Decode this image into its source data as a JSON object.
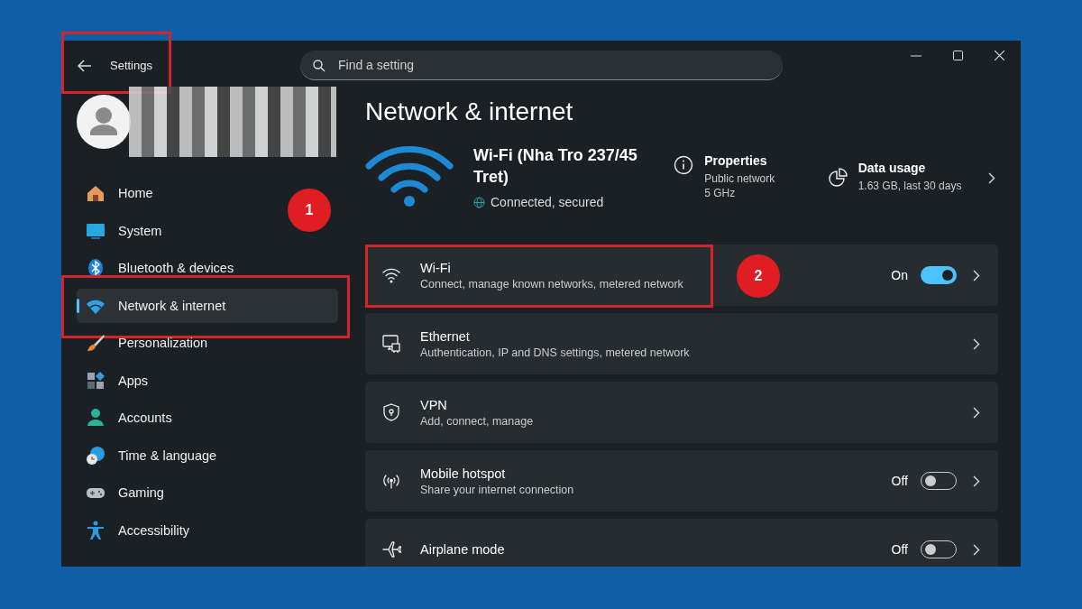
{
  "window": {
    "title": "Settings",
    "highlighted": true
  },
  "search": {
    "placeholder": "Find a setting"
  },
  "sidebar": {
    "items": [
      {
        "label": "Home",
        "kind": "home",
        "selected": false,
        "highlighted": false
      },
      {
        "label": "System",
        "kind": "system",
        "selected": false,
        "highlighted": false
      },
      {
        "label": "Bluetooth & devices",
        "kind": "bluetooth",
        "selected": false,
        "highlighted": false
      },
      {
        "label": "Network & internet",
        "kind": "network",
        "selected": true,
        "highlighted": true,
        "callout": "1"
      },
      {
        "label": "Personalization",
        "kind": "brush",
        "selected": false,
        "highlighted": false
      },
      {
        "label": "Apps",
        "kind": "apps",
        "selected": false,
        "highlighted": false
      },
      {
        "label": "Accounts",
        "kind": "account",
        "selected": false,
        "highlighted": false
      },
      {
        "label": "Time & language",
        "kind": "time",
        "selected": false,
        "highlighted": false
      },
      {
        "label": "Gaming",
        "kind": "gaming",
        "selected": false,
        "highlighted": false
      },
      {
        "label": "Accessibility",
        "kind": "accessibility",
        "selected": false,
        "highlighted": false
      }
    ]
  },
  "page": {
    "title": "Network & internet"
  },
  "connection": {
    "name": "Wi-Fi (Nha Tro 237/45 Tret)",
    "status": "Connected, secured",
    "properties": {
      "title": "Properties",
      "lines": [
        "Public network",
        "5 GHz"
      ]
    },
    "data_usage": {
      "title": "Data usage",
      "detail": "1.63 GB, last 30 days"
    }
  },
  "rows": [
    {
      "kind": "toggle",
      "title": "Wi-Fi",
      "subtitle": "Connect, manage known networks, metered network",
      "status": "On",
      "on": true,
      "highlighted": true,
      "callout": "2"
    },
    {
      "kind": "link",
      "title": "Ethernet",
      "subtitle": "Authentication, IP and DNS settings, metered network",
      "highlighted": false
    },
    {
      "kind": "link",
      "title": "VPN",
      "subtitle": "Add, connect, manage",
      "highlighted": false
    },
    {
      "kind": "toggle",
      "title": "Mobile hotspot",
      "subtitle": "Share your internet connection",
      "status": "Off",
      "on": false,
      "highlighted": false
    },
    {
      "kind": "toggle",
      "title": "Airplane mode",
      "status": "Off",
      "on": false,
      "highlighted": false
    }
  ]
}
